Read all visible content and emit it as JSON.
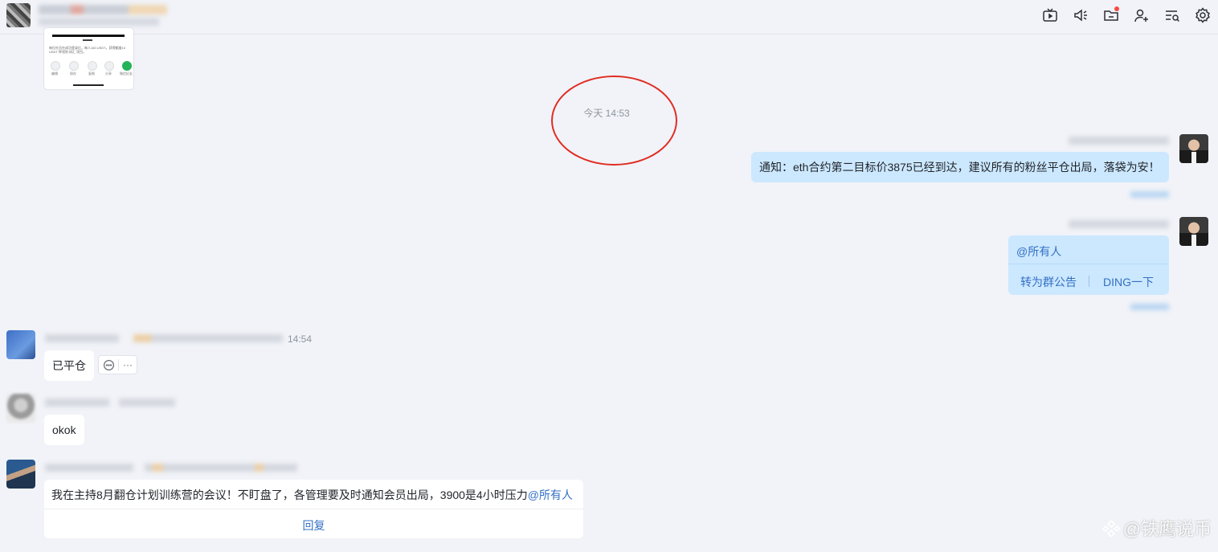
{
  "header": {
    "toolbar_icons": [
      "video-icon",
      "speaker-icon",
      "folder-icon",
      "add-member-icon",
      "search-list-icon",
      "settings-icon"
    ],
    "folder_has_notification": true
  },
  "timeline": {
    "timestamp": "今天 14:53",
    "annotation_color": "#e02d23"
  },
  "messages": {
    "m1": {
      "text": "通知：eth合约第二目标价3875已经到达，建议所有的粉丝平仓出局，落袋为安！"
    },
    "m2": {
      "mention": "@所有人",
      "action_announcement": "转为群公告",
      "action_ding": "DING一下"
    },
    "m3": {
      "time": "14:54",
      "text": "已平仓"
    },
    "m4": {
      "text": "okok"
    },
    "m5": {
      "text": "我在主持8月翻仓计划训练营的会议！不盯盘了，各管理要及时通知会员出局，3900是4小时压力",
      "mention": "@所有人",
      "reply_label": "回复"
    }
  },
  "shared_image": {
    "caption_text": "每位社员在成功登录后，每人160 USDT。获得额度10 USDT 将领到 研汇 项目。",
    "actions": [
      "编辑",
      "保存",
      "复制",
      "分享",
      "微信好友"
    ]
  },
  "watermark": {
    "text": "@铁鹰说币"
  },
  "colors": {
    "my_bubble": "#cce8ff",
    "link": "#3370c4",
    "background": "#f1f3f8"
  }
}
